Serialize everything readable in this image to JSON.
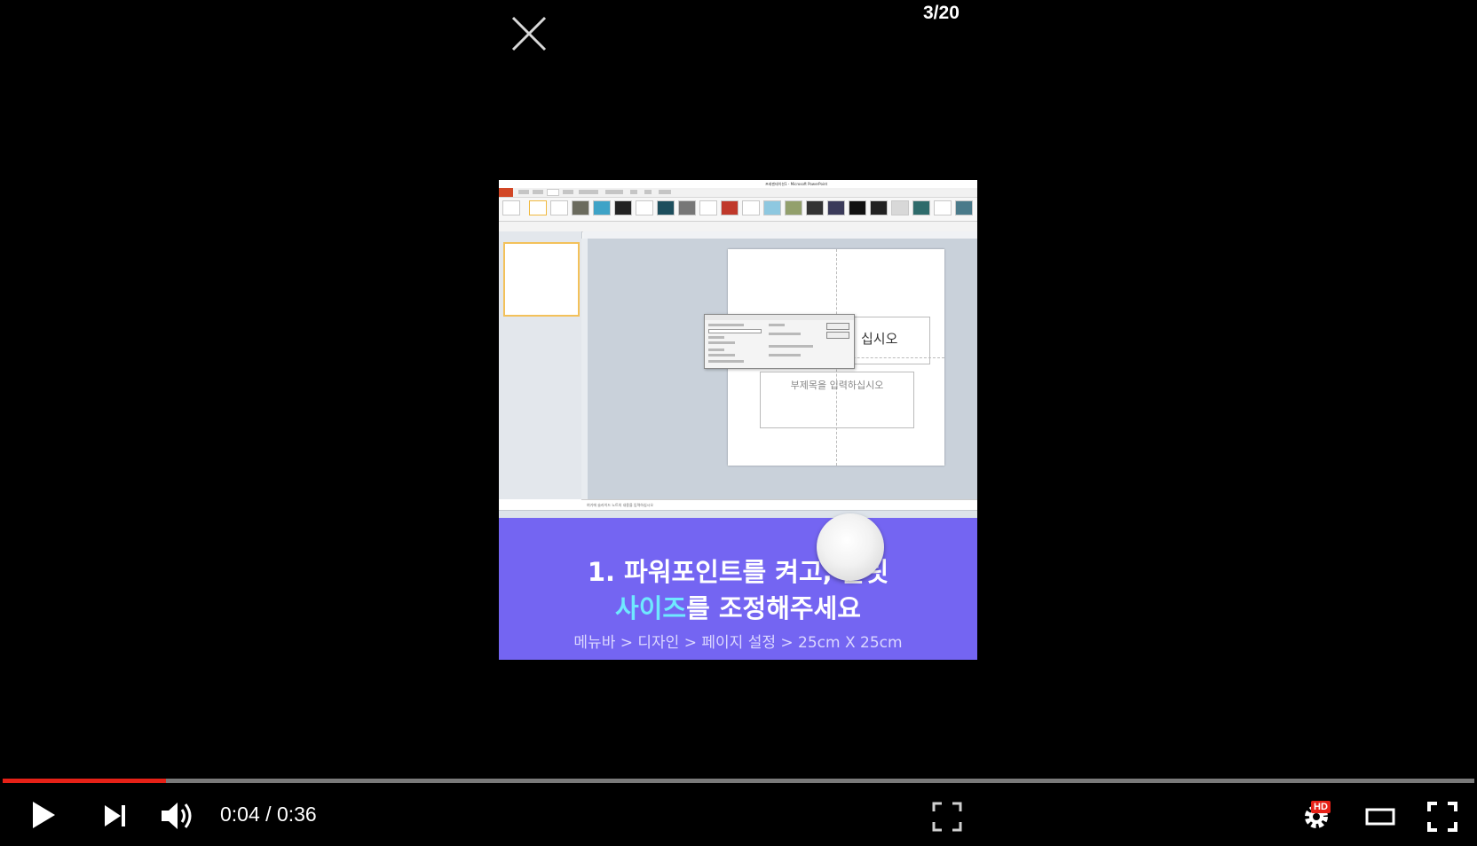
{
  "counter": "3/20",
  "video": {
    "app_window_title": "프레젠테이션1 - Microsoft PowerPoint",
    "slide_title_text": "십시오",
    "slide_subtitle_placeholder": "부제목을 입력하십시오",
    "notes_placeholder": "여기에 슬라이드 노트의 내용을 입력하십시오",
    "caption": {
      "line1": "1. 파워포인트를 켜고, 슬릿",
      "line2_highlight": "사이즈",
      "line2_rest": "를 조정해주세요",
      "line3": "메뉴바 > 디자인 > 페이지 설정 > 25cm X 25cm",
      "highlight_color": "#6fe9ff",
      "background_color": "#7465f2"
    }
  },
  "player": {
    "time_current": "0:04",
    "time_separator": " / ",
    "time_total": "0:36",
    "progress": 0.1111,
    "progress_color": "#e62117",
    "hd_label": "HD",
    "icons": [
      "close-icon",
      "play-icon",
      "next-icon",
      "volume-icon",
      "miniplayer-icon",
      "settings-icon",
      "theater-icon",
      "fullscreen-icon"
    ]
  }
}
